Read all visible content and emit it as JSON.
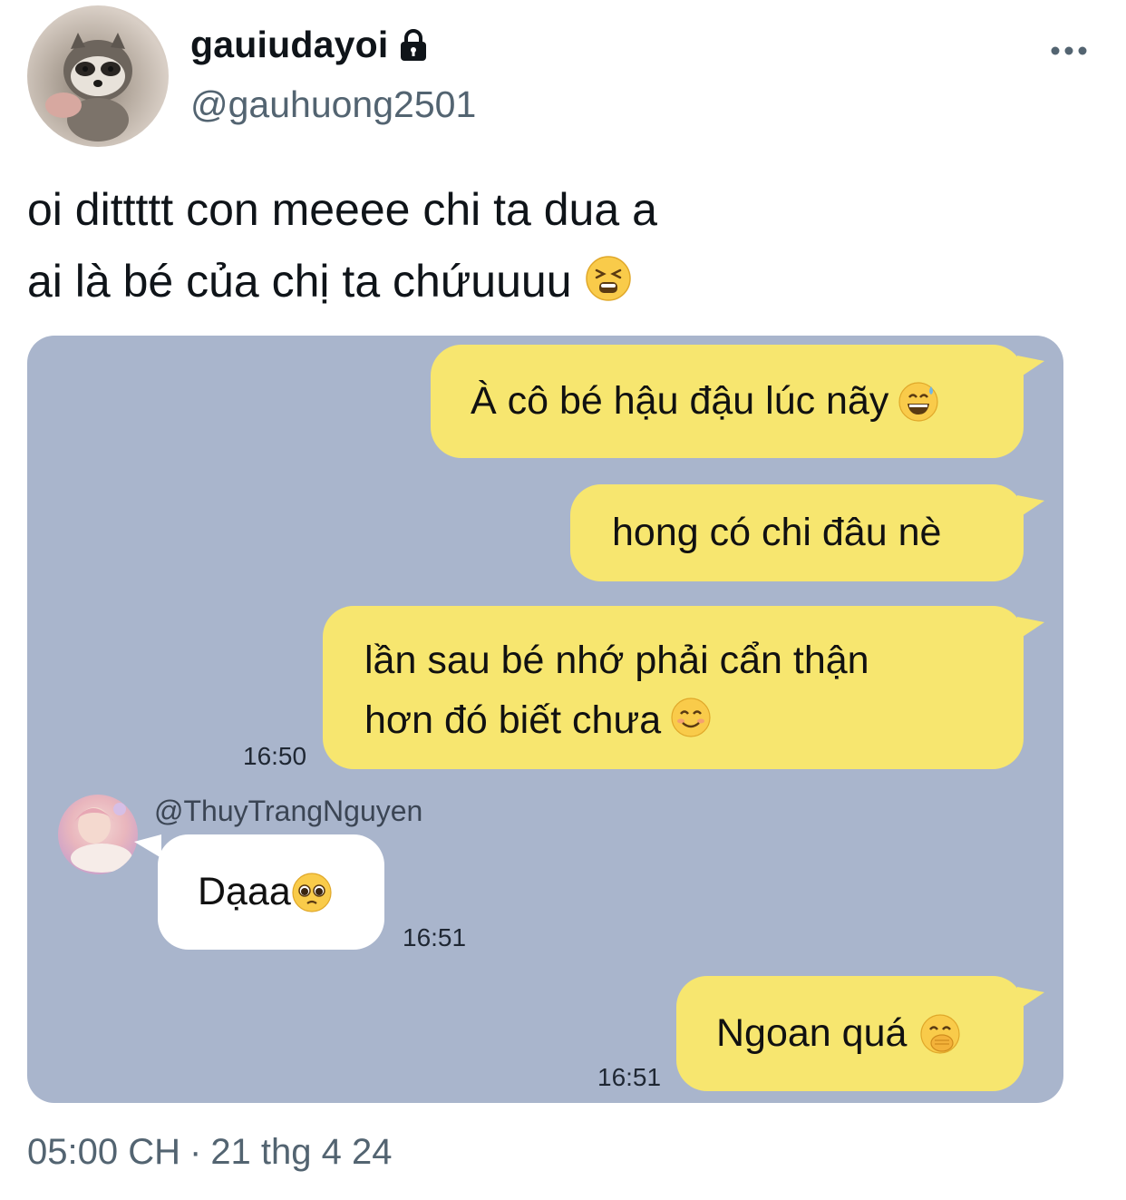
{
  "author": {
    "display_name": "gauiudayoi",
    "handle": "@gauhuong2501"
  },
  "tweet": {
    "text": "oi dittttt con meeee chi ta dua a\nai là bé của chị ta chứuuuu"
  },
  "chat": {
    "messages": [
      {
        "text": "À cô bé hậu đậu lúc nãy"
      },
      {
        "text": "hong có chi đâu nè"
      },
      {
        "text": "lần sau bé nhớ phải cẩn thận\nhơn đó biết chưa",
        "time": "16:50"
      },
      {
        "sender": "@ThuyTrangNguyen",
        "text": "Dạaa",
        "time": "16:51"
      },
      {
        "text": "Ngoan quá",
        "time": "16:51"
      }
    ]
  },
  "meta": {
    "time": "05:00 CH",
    "separator": "·",
    "date": "21 thg 4 24"
  },
  "colors": {
    "chat_background": "#a9b5cc",
    "own_bubble": "#f7e66f",
    "other_bubble": "#ffffff",
    "secondary_text": "#536471"
  },
  "icons": [
    "lock-icon",
    "more-icon",
    "tired-face-emoji",
    "grinning-sweat-emoji",
    "smiling-face-emoji",
    "pleading-face-emoji",
    "hand-over-mouth-emoji"
  ]
}
